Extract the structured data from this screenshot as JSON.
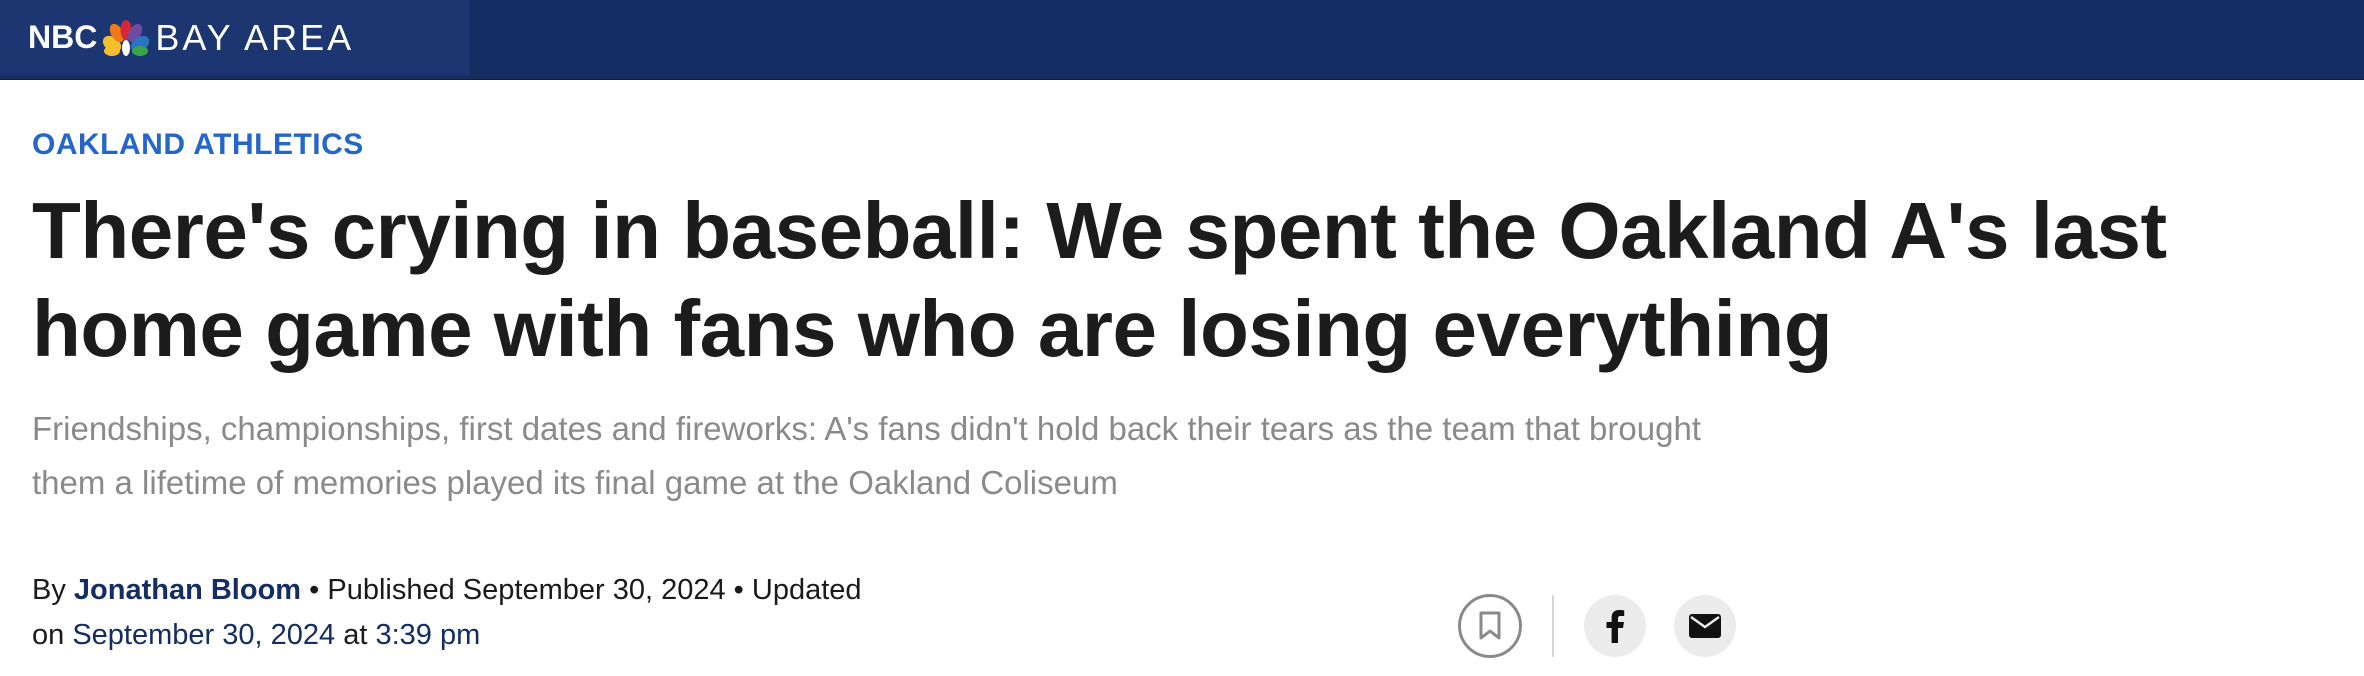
{
  "header": {
    "logo_nbc": "NBC",
    "logo_bay": "BAY AREA",
    "brand_colors": {
      "bar": "#142d63",
      "logo_bg": "#1b3670"
    }
  },
  "article": {
    "category": "OAKLAND ATHLETICS",
    "headline": "There's crying in baseball: We spent the Oakland A's last home game with fans who are losing everything",
    "subheadline": "Friendships, championships, first dates and fireworks: A's fans didn't hold back their tears as the team that brought them a lifetime of memories played its final game at the Oakland Coliseum",
    "byline": {
      "by_prefix": "By",
      "author": "Jonathan Bloom",
      "published_prefix": "Published",
      "published_date": "September 30, 2024",
      "updated_prefix": "Updated",
      "on_prefix": "on",
      "updated_date": "September 30, 2024",
      "at_word": "at",
      "updated_time": "3:39 pm",
      "separator": "•"
    }
  },
  "actions": {
    "bookmark_icon": "bookmark-icon",
    "facebook_icon": "facebook-icon",
    "email_icon": "email-icon"
  },
  "colors": {
    "category": "#2466c9",
    "author": "#142d63",
    "subhead": "#8a8a8a"
  }
}
